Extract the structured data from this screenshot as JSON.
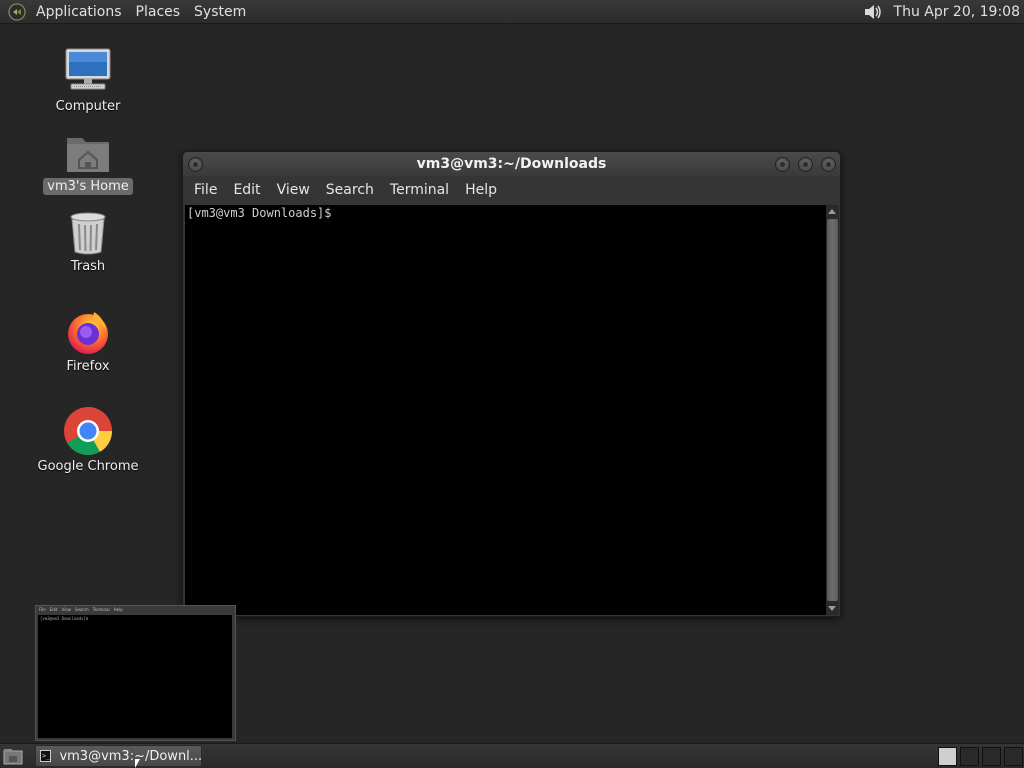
{
  "top_panel": {
    "menus": [
      "Applications",
      "Places",
      "System"
    ],
    "clock": "Thu Apr 20, 19:08"
  },
  "desktop": {
    "icons": [
      {
        "label": "Computer"
      },
      {
        "label": "vm3's Home"
      },
      {
        "label": "Trash"
      },
      {
        "label": "Firefox"
      },
      {
        "label": "Google Chrome"
      }
    ]
  },
  "terminal": {
    "title": "vm3@vm3:~/Downloads",
    "menu": [
      "File",
      "Edit",
      "View",
      "Search",
      "Terminal",
      "Help"
    ],
    "prompt": "[vm3@vm3 Downloads]$"
  },
  "preview": {
    "menu": [
      "File",
      "Edit",
      "View",
      "Search",
      "Terminal",
      "Help"
    ],
    "prompt": "[vm3@vm3 Downloads]$"
  },
  "taskbar": {
    "task_label": "vm3@vm3:~/Downl..."
  }
}
